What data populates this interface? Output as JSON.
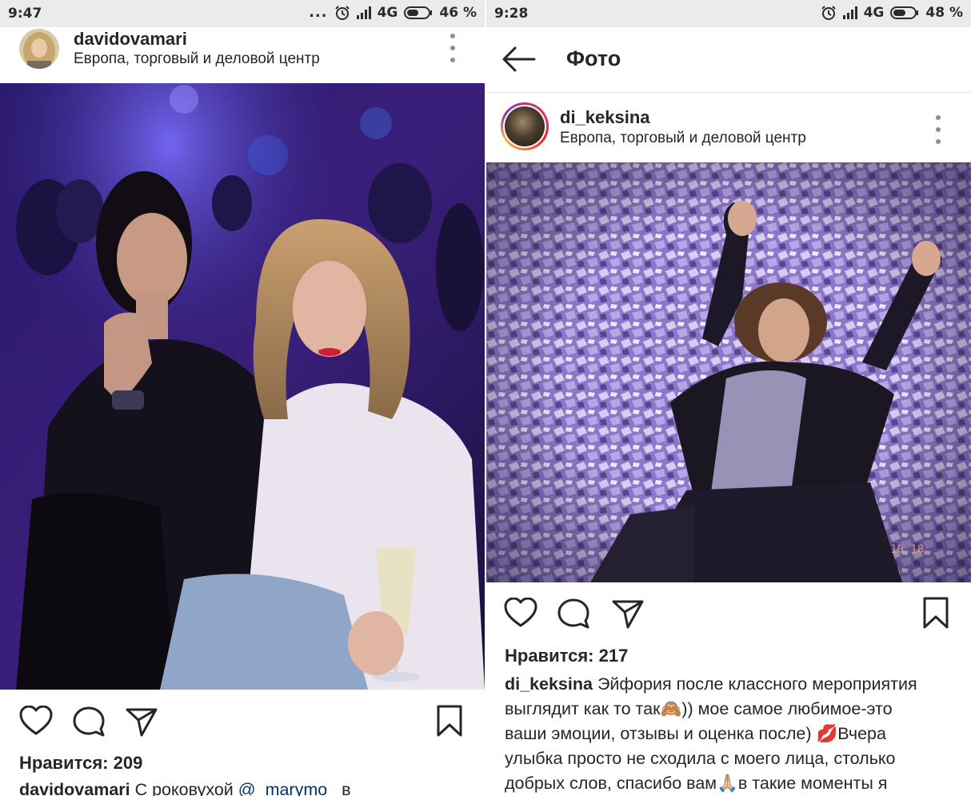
{
  "left": {
    "status": {
      "time": "9:47",
      "dots": "...",
      "network": "4G",
      "battery": "46 %"
    },
    "post": {
      "username": "davidovamari",
      "location": "Европа, торговый и деловой центр",
      "likes": "Нравится: 209",
      "caption_user": "davidovamari",
      "caption_text": " С роковухой ",
      "caption_mention": "@_marymo_",
      "caption_rest": " в"
    }
  },
  "right": {
    "status": {
      "time": "9:28",
      "network": "4G",
      "battery": "48 %"
    },
    "topbar": {
      "title": "Фото"
    },
    "post": {
      "username": "di_keksina",
      "location": "Европа, торговый и деловой центр",
      "likes": "Нравится: 217",
      "caption_user": "di_keksina",
      "caption_lines": [
        " Эйфория после классного мероприятия",
        "выглядит как то так🙈)) мое самое  любимое-это",
        "ваши эмоции, отзывы и оценка после) 💋Вчера",
        "улыбка просто не сходила с моего лица, столько",
        "добрых слов, спасибо вам🙏🏼в такие моменты я"
      ]
    }
  },
  "icons": {
    "like": "heart-icon",
    "comment": "comment-icon",
    "share": "send-icon",
    "save": "bookmark-icon",
    "back": "back-arrow-icon",
    "more": "more-vertical-icon",
    "alarm": "alarm-icon",
    "signal": "signal-icon",
    "battery": "battery-icon"
  }
}
